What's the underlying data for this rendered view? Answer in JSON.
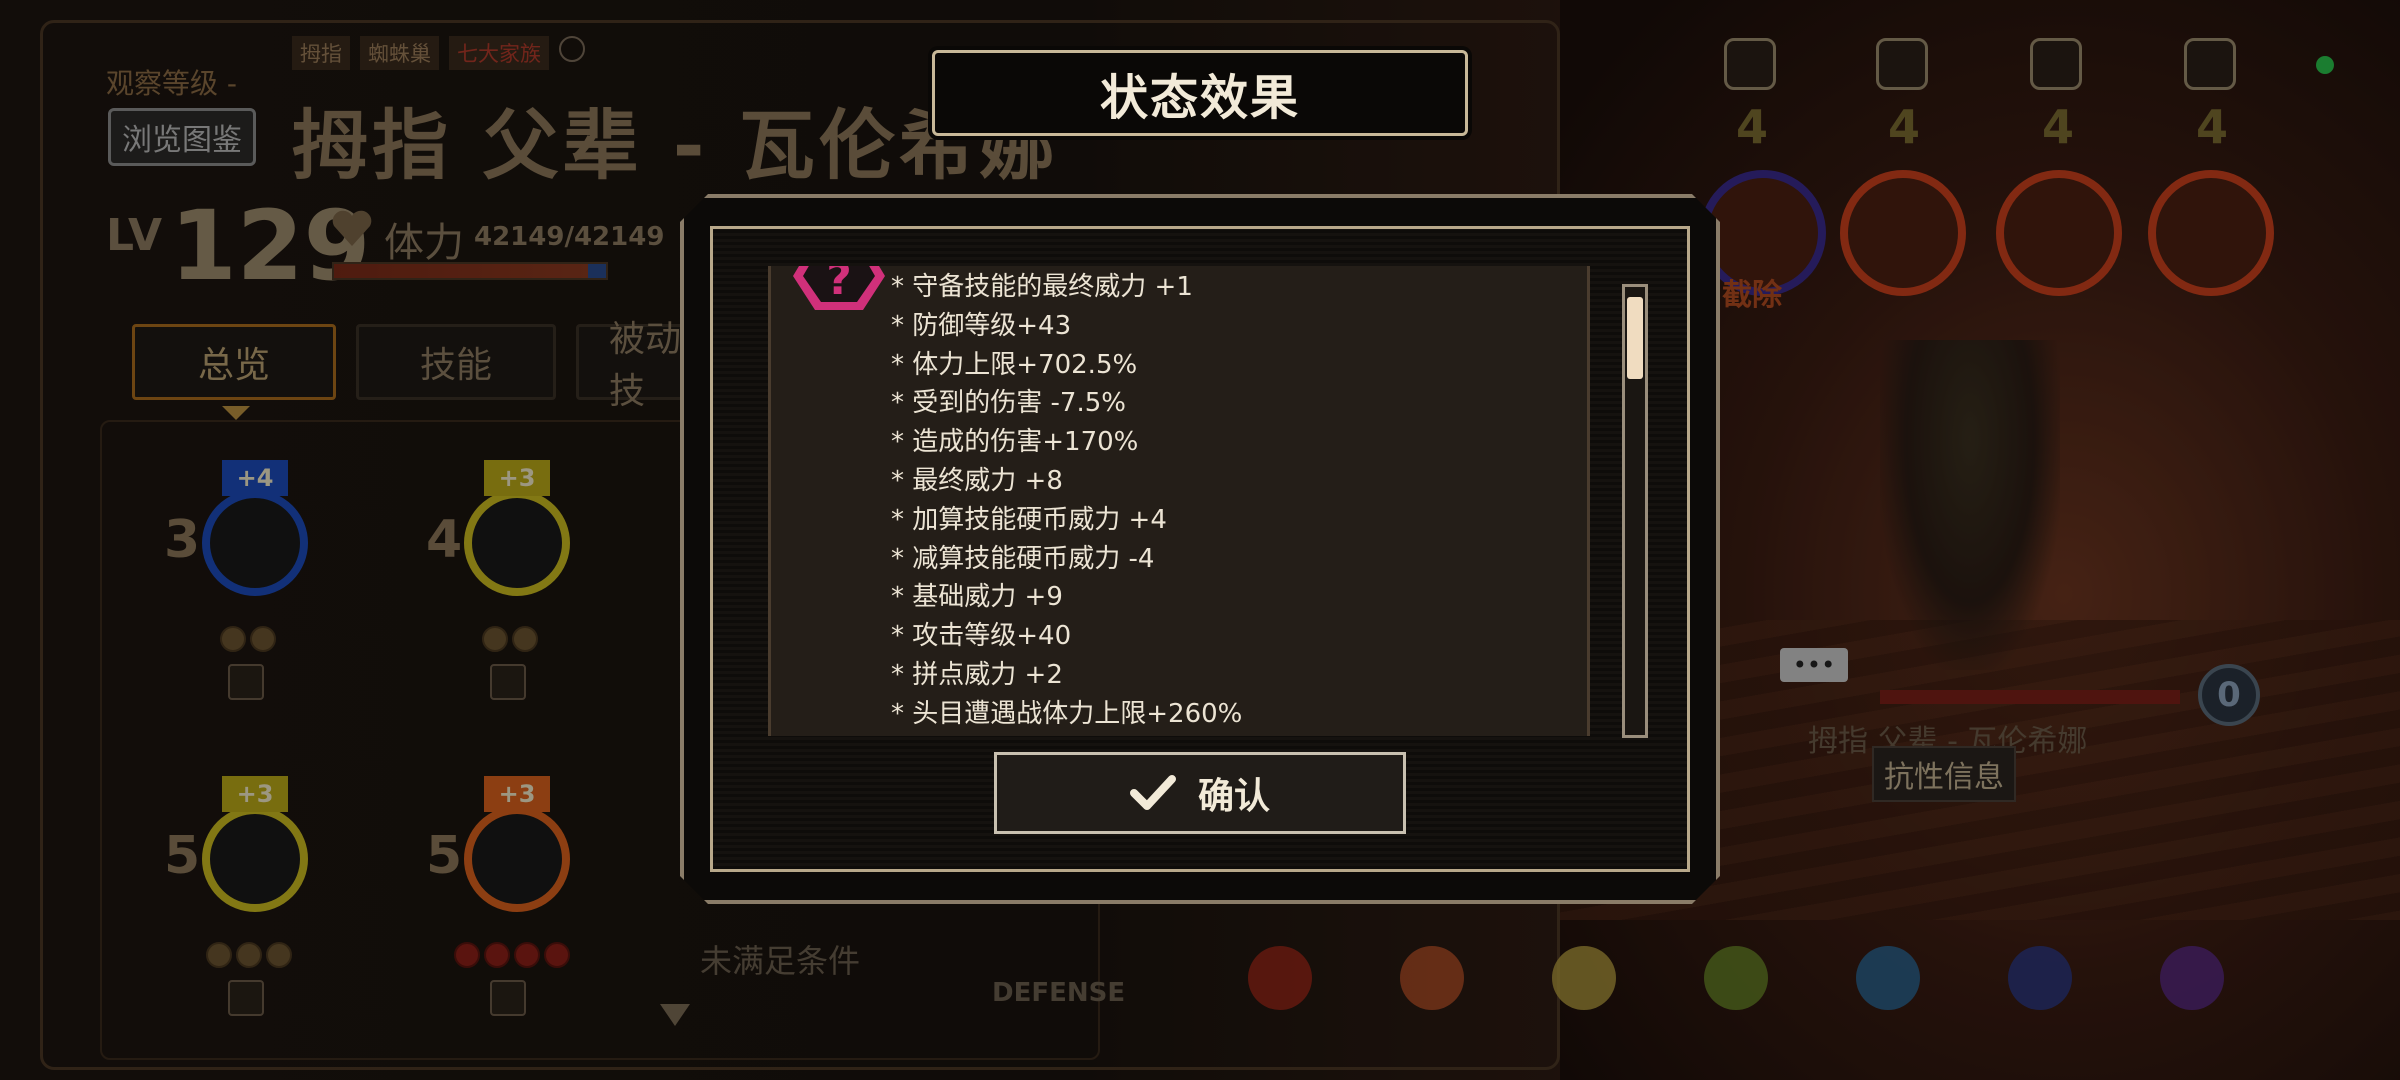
{
  "header": {
    "observe_label": "观察等级 -",
    "browse_button": "浏览图鉴",
    "tags": [
      "拇指",
      "蜘蛛巢",
      "七大家族"
    ],
    "char_name": "拇指 父辈 - 瓦伦希娜",
    "lv_label": "LV",
    "lv_value": "129",
    "hp_label": "体力",
    "hp_value": "42149/42149"
  },
  "tabs": [
    {
      "label": "总览"
    },
    {
      "label": "技能"
    },
    {
      "label": "被动技"
    }
  ],
  "skills": [
    {
      "count": "3",
      "bonus": "+4",
      "color": "#1c4ab8"
    },
    {
      "count": "4",
      "bonus": "+3",
      "color": "#c8b820"
    },
    {
      "count": "5",
      "bonus": "+3",
      "color": "#c8b820"
    },
    {
      "count": "5",
      "bonus": "+3",
      "color": "#d8601c"
    }
  ],
  "skill_area": {
    "unmet": "未满足条件",
    "defense": "DEFENSE"
  },
  "right_panel": {
    "top_numbers": [
      "4",
      "4",
      "4",
      "4"
    ],
    "destroy_text": "和截除",
    "unit_name": "拇指 父辈 - 瓦伦希娜",
    "resist_label": "抗性信息",
    "round_value": "0",
    "dots": "•••"
  },
  "modal": {
    "title": "状态效果",
    "effects": [
      "* 守备技能的最终威力 +1",
      "* 防御等级+43",
      "* 体力上限+702.5%",
      "* 受到的伤害 -7.5%",
      "* 造成的伤害+170%",
      "* 最终威力 +8",
      "* 加算技能硬币威力 +4",
      "* 减算技能硬币威力 -4",
      "* 基础威力 +9",
      "* 攻击等级+40",
      "* 拼点威力 +2",
      "* 头目遭遇战体力上限+260%"
    ],
    "confirm_label": "确认",
    "scroll_position": 0
  },
  "colors": {
    "accent": "#a86a1c",
    "panel_bg": "#241e18",
    "text_light": "#ece4d4",
    "badge_pink": "#d0307a"
  },
  "icons": {
    "confirm": "check-icon",
    "effect_badge": "question-badge-icon",
    "hp": "heart-icon"
  }
}
